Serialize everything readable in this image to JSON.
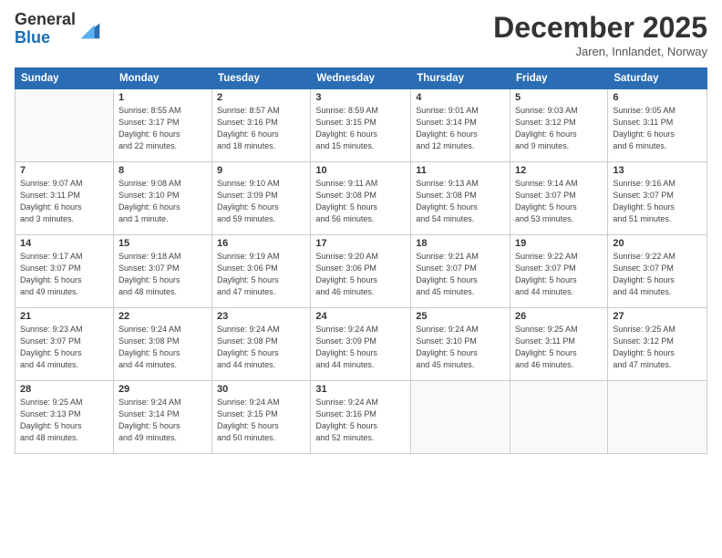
{
  "header": {
    "logo_line1": "General",
    "logo_line2": "Blue",
    "month": "December 2025",
    "location": "Jaren, Innlandet, Norway"
  },
  "days_of_week": [
    "Sunday",
    "Monday",
    "Tuesday",
    "Wednesday",
    "Thursday",
    "Friday",
    "Saturday"
  ],
  "weeks": [
    [
      {
        "day": "",
        "info": ""
      },
      {
        "day": "1",
        "info": "Sunrise: 8:55 AM\nSunset: 3:17 PM\nDaylight: 6 hours\nand 22 minutes."
      },
      {
        "day": "2",
        "info": "Sunrise: 8:57 AM\nSunset: 3:16 PM\nDaylight: 6 hours\nand 18 minutes."
      },
      {
        "day": "3",
        "info": "Sunrise: 8:59 AM\nSunset: 3:15 PM\nDaylight: 6 hours\nand 15 minutes."
      },
      {
        "day": "4",
        "info": "Sunrise: 9:01 AM\nSunset: 3:14 PM\nDaylight: 6 hours\nand 12 minutes."
      },
      {
        "day": "5",
        "info": "Sunrise: 9:03 AM\nSunset: 3:12 PM\nDaylight: 6 hours\nand 9 minutes."
      },
      {
        "day": "6",
        "info": "Sunrise: 9:05 AM\nSunset: 3:11 PM\nDaylight: 6 hours\nand 6 minutes."
      }
    ],
    [
      {
        "day": "7",
        "info": "Sunrise: 9:07 AM\nSunset: 3:11 PM\nDaylight: 6 hours\nand 3 minutes."
      },
      {
        "day": "8",
        "info": "Sunrise: 9:08 AM\nSunset: 3:10 PM\nDaylight: 6 hours\nand 1 minute."
      },
      {
        "day": "9",
        "info": "Sunrise: 9:10 AM\nSunset: 3:09 PM\nDaylight: 5 hours\nand 59 minutes."
      },
      {
        "day": "10",
        "info": "Sunrise: 9:11 AM\nSunset: 3:08 PM\nDaylight: 5 hours\nand 56 minutes."
      },
      {
        "day": "11",
        "info": "Sunrise: 9:13 AM\nSunset: 3:08 PM\nDaylight: 5 hours\nand 54 minutes."
      },
      {
        "day": "12",
        "info": "Sunrise: 9:14 AM\nSunset: 3:07 PM\nDaylight: 5 hours\nand 53 minutes."
      },
      {
        "day": "13",
        "info": "Sunrise: 9:16 AM\nSunset: 3:07 PM\nDaylight: 5 hours\nand 51 minutes."
      }
    ],
    [
      {
        "day": "14",
        "info": "Sunrise: 9:17 AM\nSunset: 3:07 PM\nDaylight: 5 hours\nand 49 minutes."
      },
      {
        "day": "15",
        "info": "Sunrise: 9:18 AM\nSunset: 3:07 PM\nDaylight: 5 hours\nand 48 minutes."
      },
      {
        "day": "16",
        "info": "Sunrise: 9:19 AM\nSunset: 3:06 PM\nDaylight: 5 hours\nand 47 minutes."
      },
      {
        "day": "17",
        "info": "Sunrise: 9:20 AM\nSunset: 3:06 PM\nDaylight: 5 hours\nand 46 minutes."
      },
      {
        "day": "18",
        "info": "Sunrise: 9:21 AM\nSunset: 3:07 PM\nDaylight: 5 hours\nand 45 minutes."
      },
      {
        "day": "19",
        "info": "Sunrise: 9:22 AM\nSunset: 3:07 PM\nDaylight: 5 hours\nand 44 minutes."
      },
      {
        "day": "20",
        "info": "Sunrise: 9:22 AM\nSunset: 3:07 PM\nDaylight: 5 hours\nand 44 minutes."
      }
    ],
    [
      {
        "day": "21",
        "info": "Sunrise: 9:23 AM\nSunset: 3:07 PM\nDaylight: 5 hours\nand 44 minutes."
      },
      {
        "day": "22",
        "info": "Sunrise: 9:24 AM\nSunset: 3:08 PM\nDaylight: 5 hours\nand 44 minutes."
      },
      {
        "day": "23",
        "info": "Sunrise: 9:24 AM\nSunset: 3:08 PM\nDaylight: 5 hours\nand 44 minutes."
      },
      {
        "day": "24",
        "info": "Sunrise: 9:24 AM\nSunset: 3:09 PM\nDaylight: 5 hours\nand 44 minutes."
      },
      {
        "day": "25",
        "info": "Sunrise: 9:24 AM\nSunset: 3:10 PM\nDaylight: 5 hours\nand 45 minutes."
      },
      {
        "day": "26",
        "info": "Sunrise: 9:25 AM\nSunset: 3:11 PM\nDaylight: 5 hours\nand 46 minutes."
      },
      {
        "day": "27",
        "info": "Sunrise: 9:25 AM\nSunset: 3:12 PM\nDaylight: 5 hours\nand 47 minutes."
      }
    ],
    [
      {
        "day": "28",
        "info": "Sunrise: 9:25 AM\nSunset: 3:13 PM\nDaylight: 5 hours\nand 48 minutes."
      },
      {
        "day": "29",
        "info": "Sunrise: 9:24 AM\nSunset: 3:14 PM\nDaylight: 5 hours\nand 49 minutes."
      },
      {
        "day": "30",
        "info": "Sunrise: 9:24 AM\nSunset: 3:15 PM\nDaylight: 5 hours\nand 50 minutes."
      },
      {
        "day": "31",
        "info": "Sunrise: 9:24 AM\nSunset: 3:16 PM\nDaylight: 5 hours\nand 52 minutes."
      },
      {
        "day": "",
        "info": ""
      },
      {
        "day": "",
        "info": ""
      },
      {
        "day": "",
        "info": ""
      }
    ]
  ]
}
